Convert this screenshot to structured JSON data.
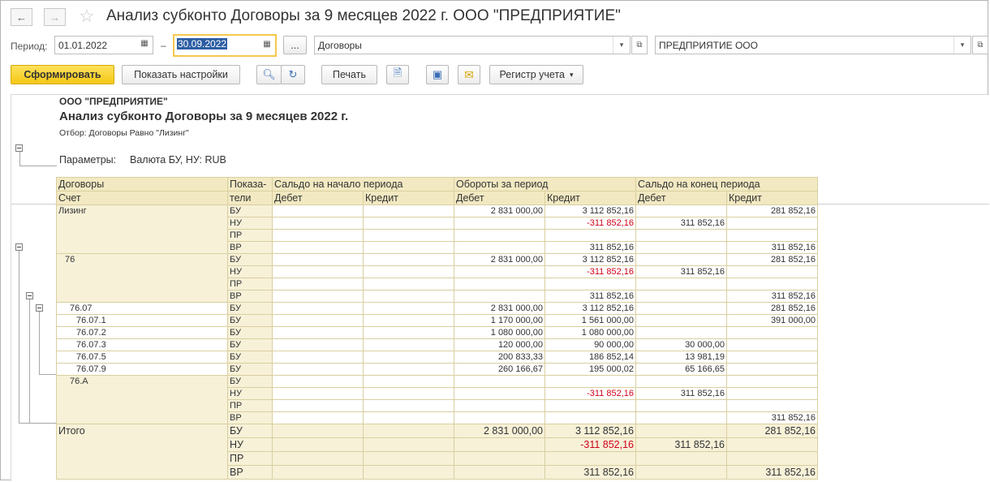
{
  "window": {
    "title": "Анализ субконто Договоры за 9 месяцев 2022 г. ООО \"ПРЕДПРИЯТИЕ\"",
    "back_icon": "arrow-left-icon",
    "forward_icon": "arrow-right-icon",
    "favorite_icon": "star-icon"
  },
  "filters": {
    "period_label": "Период:",
    "date_from": "01.01.2022",
    "dash": "–",
    "date_to": "30.09.2022",
    "more_label": "...",
    "subconto": "Договоры",
    "organization": "ПРЕДПРИЯТИЕ ООО"
  },
  "toolbar": {
    "generate": "Сформировать",
    "show_settings": "Показать настройки",
    "print": "Печать",
    "register": "Регистр учета"
  },
  "report": {
    "org": "ООО \"ПРЕДПРИЯТИЕ\"",
    "title": "Анализ субконто Договоры за 9 месяцев 2022 г.",
    "filter": "Отбор: Договоры Равно \"Лизинг\"",
    "params_label": "Параметры:",
    "params_value": "Валюта БУ, НУ: RUB",
    "headers": {
      "contracts": "Договоры",
      "indicators": "Показа-",
      "indicators2": "тели",
      "account": "Счет",
      "opening": "Сальдо на начало периода",
      "turnover": "Обороты за период",
      "closing": "Сальдо на конец периода",
      "debit": "Дебет",
      "credit": "Кредит"
    },
    "groups": [
      {
        "name": "Лизинг",
        "indent": 0,
        "rows": [
          {
            "ind": "БУ",
            "od": "",
            "oc": "",
            "td": "2 831 000,00",
            "tc": "3 112 852,16",
            "cd": "",
            "cc": "281 852,16"
          },
          {
            "ind": "НУ",
            "od": "",
            "oc": "",
            "td": "",
            "tc": "-311 852,16",
            "cd": "311 852,16",
            "cc": ""
          },
          {
            "ind": "ПР",
            "od": "",
            "oc": "",
            "td": "",
            "tc": "",
            "cd": "",
            "cc": ""
          },
          {
            "ind": "ВР",
            "od": "",
            "oc": "",
            "td": "",
            "tc": "311 852,16",
            "cd": "",
            "cc": "311 852,16"
          }
        ]
      },
      {
        "name": "76",
        "indent": 8,
        "rows": [
          {
            "ind": "БУ",
            "od": "",
            "oc": "",
            "td": "2 831 000,00",
            "tc": "3 112 852,16",
            "cd": "",
            "cc": "281 852,16"
          },
          {
            "ind": "НУ",
            "od": "",
            "oc": "",
            "td": "",
            "tc": "-311 852,16",
            "cd": "311 852,16",
            "cc": ""
          },
          {
            "ind": "ПР",
            "od": "",
            "oc": "",
            "td": "",
            "tc": "",
            "cd": "",
            "cc": ""
          },
          {
            "ind": "ВР",
            "od": "",
            "oc": "",
            "td": "",
            "tc": "311 852,16",
            "cd": "",
            "cc": "311 852,16"
          }
        ]
      },
      {
        "name": "76.07",
        "indent": 14,
        "rows": [
          {
            "ind": "БУ",
            "od": "",
            "oc": "",
            "td": "2 831 000,00",
            "tc": "3 112 852,16",
            "cd": "",
            "cc": "281 852,16"
          }
        ]
      },
      {
        "name": "76.07.1",
        "indent": 22,
        "rows": [
          {
            "ind": "БУ",
            "od": "",
            "oc": "",
            "td": "1 170 000,00",
            "tc": "1 561 000,00",
            "cd": "",
            "cc": "391 000,00"
          }
        ]
      },
      {
        "name": "76.07.2",
        "indent": 22,
        "rows": [
          {
            "ind": "БУ",
            "od": "",
            "oc": "",
            "td": "1 080 000,00",
            "tc": "1 080 000,00",
            "cd": "",
            "cc": ""
          }
        ]
      },
      {
        "name": "76.07.3",
        "indent": 22,
        "rows": [
          {
            "ind": "БУ",
            "od": "",
            "oc": "",
            "td": "120 000,00",
            "tc": "90 000,00",
            "cd": "30 000,00",
            "cc": ""
          }
        ]
      },
      {
        "name": "76.07.5",
        "indent": 22,
        "rows": [
          {
            "ind": "БУ",
            "od": "",
            "oc": "",
            "td": "200 833,33",
            "tc": "186 852,14",
            "cd": "13 981,19",
            "cc": ""
          }
        ]
      },
      {
        "name": "76.07.9",
        "indent": 22,
        "rows": [
          {
            "ind": "БУ",
            "od": "",
            "oc": "",
            "td": "260 166,67",
            "tc": "195 000,02",
            "cd": "65 166,65",
            "cc": ""
          }
        ]
      },
      {
        "name": "76.А",
        "indent": 14,
        "rows": [
          {
            "ind": "БУ",
            "od": "",
            "oc": "",
            "td": "",
            "tc": "",
            "cd": "",
            "cc": ""
          },
          {
            "ind": "НУ",
            "od": "",
            "oc": "",
            "td": "",
            "tc": "-311 852,16",
            "cd": "311 852,16",
            "cc": ""
          },
          {
            "ind": "ПР",
            "od": "",
            "oc": "",
            "td": "",
            "tc": "",
            "cd": "",
            "cc": ""
          },
          {
            "ind": "ВР",
            "od": "",
            "oc": "",
            "td": "",
            "tc": "",
            "cd": "",
            "cc": "311 852,16"
          }
        ]
      }
    ],
    "total": {
      "name": "Итого",
      "rows": [
        {
          "ind": "БУ",
          "od": "",
          "oc": "",
          "td": "2 831 000,00",
          "tc": "3 112 852,16",
          "cd": "",
          "cc": "281 852,16"
        },
        {
          "ind": "НУ",
          "od": "",
          "oc": "",
          "td": "",
          "tc": "-311 852,16",
          "cd": "311 852,16",
          "cc": ""
        },
        {
          "ind": "ПР",
          "od": "",
          "oc": "",
          "td": "",
          "tc": "",
          "cd": "",
          "cc": ""
        },
        {
          "ind": "ВР",
          "od": "",
          "oc": "",
          "td": "",
          "tc": "311 852,16",
          "cd": "",
          "cc": "311 852,16"
        }
      ]
    }
  }
}
